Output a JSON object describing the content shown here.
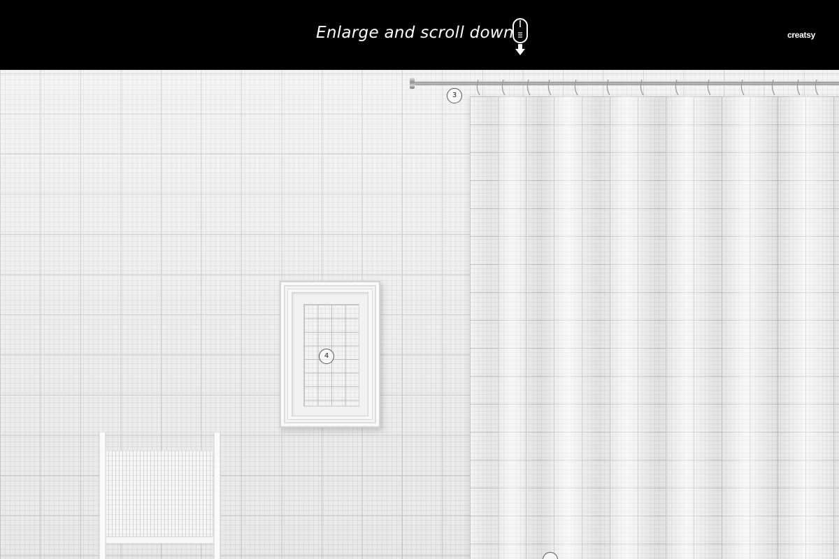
{
  "banner": {
    "instruction_text": "Enlarge and scroll down",
    "brand_text": "creatsy",
    "icon": "mouse-scroll-down-icon",
    "background_color": "#000000",
    "text_color": "#ffffff"
  },
  "scene": {
    "markers": [
      {
        "label": "3",
        "target": "curtain-rod"
      },
      {
        "label": "4",
        "target": "picture-frame"
      },
      {
        "label": "",
        "target": "curtain-bottom"
      }
    ]
  }
}
